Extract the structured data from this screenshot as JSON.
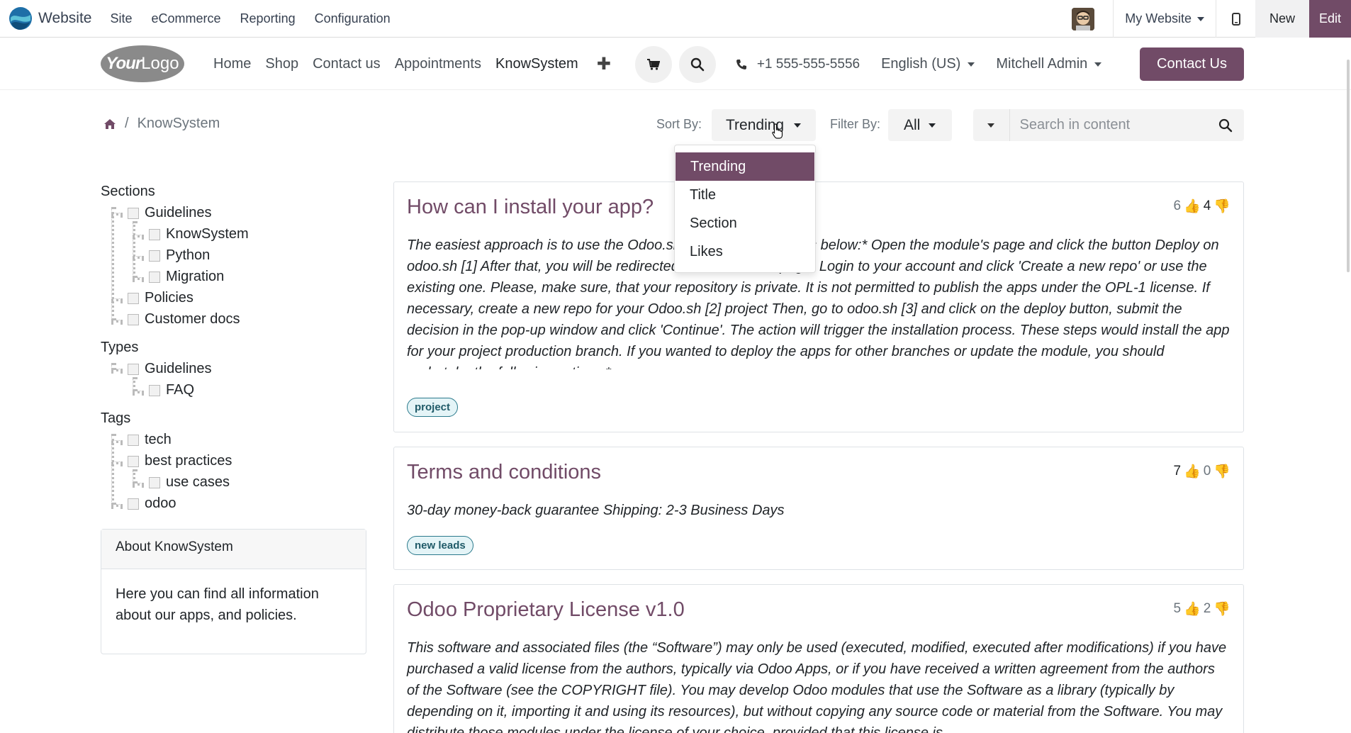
{
  "admin_bar": {
    "app_name": "Website",
    "menus": [
      "Site",
      "eCommerce",
      "Reporting",
      "Configuration"
    ],
    "my_website": "My Website",
    "new_label": "New",
    "edit_label": "Edit",
    "accent_color": "#714b67"
  },
  "header": {
    "logo_text_bold": "Your",
    "logo_text_light": "Logo",
    "nav": [
      "Home",
      "Shop",
      "Contact us",
      "Appointments",
      "KnowSystem"
    ],
    "active_nav": "KnowSystem",
    "phone": "+1 555-555-5556",
    "language": "English (US)",
    "user": "Mitchell Admin",
    "contact_button": "Contact Us"
  },
  "breadcrumb": {
    "current": "KnowSystem"
  },
  "toolbar": {
    "sort_label": "Sort By:",
    "sort_value": "Trending",
    "filter_label": "Filter By:",
    "filter_value": "All",
    "search_placeholder": "Search in content"
  },
  "sort_menu": {
    "items": [
      "Trending",
      "Title",
      "Section",
      "Likes"
    ],
    "selected": "Trending"
  },
  "sidebar": {
    "sections_title": "Sections",
    "sections": [
      "Guidelines",
      "KnowSystem",
      "Python",
      "Migration",
      "Policies",
      "Customer docs"
    ],
    "types_title": "Types",
    "types": [
      "Guidelines",
      "FAQ"
    ],
    "tags_title": "Tags",
    "tags": [
      "tech",
      "best practices",
      "use cases",
      "odoo"
    ],
    "about_title": "About KnowSystem",
    "about_text": "Here you can find all information about our apps, and policies."
  },
  "articles": [
    {
      "title": "How can I install your app?",
      "likes": "6",
      "dislikes": "4",
      "body": "The easiest approach is to use the Odoo.sh. Just follow the steps below:* Open the module's page and click the button Deploy on odoo.sh [1] After that, you will be redirected to the Odoo.sh page. Login to your account and click 'Create a new repo' or use the existing one. Please, make sure, that your repository is private. It is not permitted to publish the apps under the OPL-1 license. If necessary, create a new repo for your Odoo.sh [2] project Then, go to odoo.sh [3] and click on the deploy button, submit the decision in the pop-up window and click 'Continue'. The action will trigger the installation process. These steps would install the app for your project production branch. If you wanted to deploy the apps for other branches or update the module, you should undertake the following actions:*",
      "tag": "project"
    },
    {
      "title": "Terms and conditions",
      "likes": "7",
      "dislikes": "0",
      "body": "30-day money-back guarantee Shipping: 2-3 Business Days",
      "tag": "new leads"
    },
    {
      "title": "Odoo Proprietary License v1.0",
      "likes": "5",
      "dislikes": "2",
      "body": "This software and associated files (the “Software”) may only be used (executed, modified, executed after modifications) if you have purchased a valid license from the authors, typically via Odoo Apps, or if you have received a written agreement from the authors of the Software (see the COPYRIGHT file). You may develop Odoo modules that use the Software as a library (typically by depending on it, importing it and using its resources), but without copying any source code or material from the Software. You may distribute those modules under the license of your choice, provided that this license is"
    }
  ]
}
